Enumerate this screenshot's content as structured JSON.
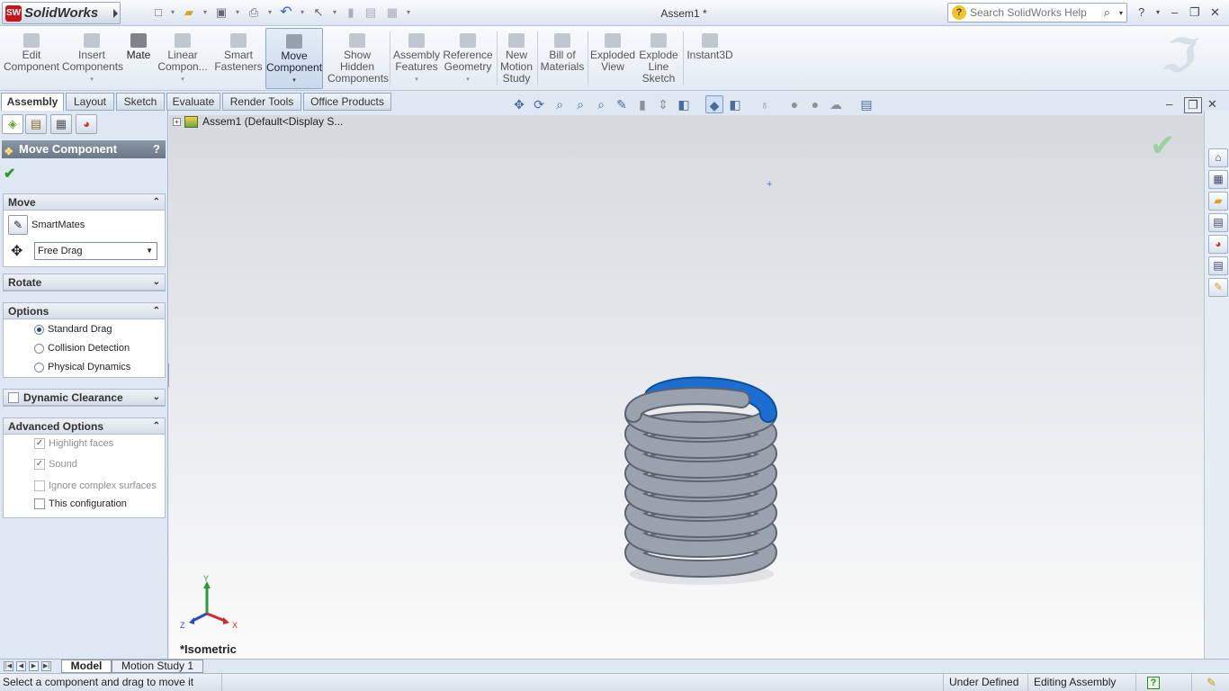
{
  "app": {
    "brand": "SolidWorks",
    "brand_badge": "SW",
    "document_title": "Assem1 *"
  },
  "search": {
    "placeholder": "Search SolidWorks Help"
  },
  "ribbon": {
    "buttons": [
      {
        "label": "Edit\nComponent",
        "icon": "edit-component-icon"
      },
      {
        "label": "Insert\nComponents",
        "icon": "insert-components-icon"
      },
      {
        "label": "Mate",
        "icon": "mate-icon"
      },
      {
        "label": "Linear\nCompon...",
        "icon": "linear-pattern-icon"
      },
      {
        "label": "Smart\nFasteners",
        "icon": "smart-fasteners-icon"
      },
      {
        "label": "Move\nComponent",
        "icon": "move-component-icon"
      },
      {
        "label": "Show\nHidden\nComponents",
        "icon": "show-hidden-icon"
      },
      {
        "label": "Assembly\nFeatures",
        "icon": "assembly-features-icon"
      },
      {
        "label": "Reference\nGeometry",
        "icon": "reference-geometry-icon"
      },
      {
        "label": "New\nMotion\nStudy",
        "icon": "motion-study-icon"
      },
      {
        "label": "Bill of\nMaterials",
        "icon": "bom-icon"
      },
      {
        "label": "Exploded\nView",
        "icon": "exploded-view-icon"
      },
      {
        "label": "Explode\nLine\nSketch",
        "icon": "explode-line-icon"
      },
      {
        "label": "Instant3D",
        "icon": "instant3d-icon"
      }
    ]
  },
  "command_tabs": [
    "Assembly",
    "Layout",
    "Sketch",
    "Evaluate",
    "Render Tools",
    "Office Products"
  ],
  "property_manager": {
    "title": "Move Component",
    "help": "?",
    "move": {
      "header": "Move",
      "smartmates": "SmartMates",
      "drag_mode": "Free Drag"
    },
    "rotate": {
      "header": "Rotate"
    },
    "options": {
      "header": "Options",
      "items": [
        "Standard Drag",
        "Collision Detection",
        "Physical Dynamics"
      ],
      "selected": "Standard Drag"
    },
    "dynamic_clearance": {
      "header": "Dynamic Clearance"
    },
    "advanced": {
      "header": "Advanced Options",
      "items": [
        {
          "label": "Highlight faces",
          "checked": true,
          "disabled": true
        },
        {
          "label": "Sound",
          "checked": true,
          "disabled": true
        },
        {
          "label": "Ignore complex surfaces",
          "checked": false,
          "disabled": true
        },
        {
          "label": "This configuration",
          "checked": false,
          "disabled": false
        }
      ]
    }
  },
  "tree": {
    "root": "Assem1  (Default<Display S..."
  },
  "viewport": {
    "view_name": "*Isometric",
    "triad": {
      "y": "Y",
      "z": "Z",
      "x": "X"
    }
  },
  "bottom_tabs": [
    "Model",
    "Motion Study 1"
  ],
  "status": {
    "message": "Select a component and drag to move it",
    "definition": "Under Defined",
    "mode": "Editing Assembly",
    "help": "?"
  },
  "colors": {
    "spring_gray": "#8d96a4",
    "spring_highlight": "#1c6fd0",
    "accent": "#c8141b"
  }
}
